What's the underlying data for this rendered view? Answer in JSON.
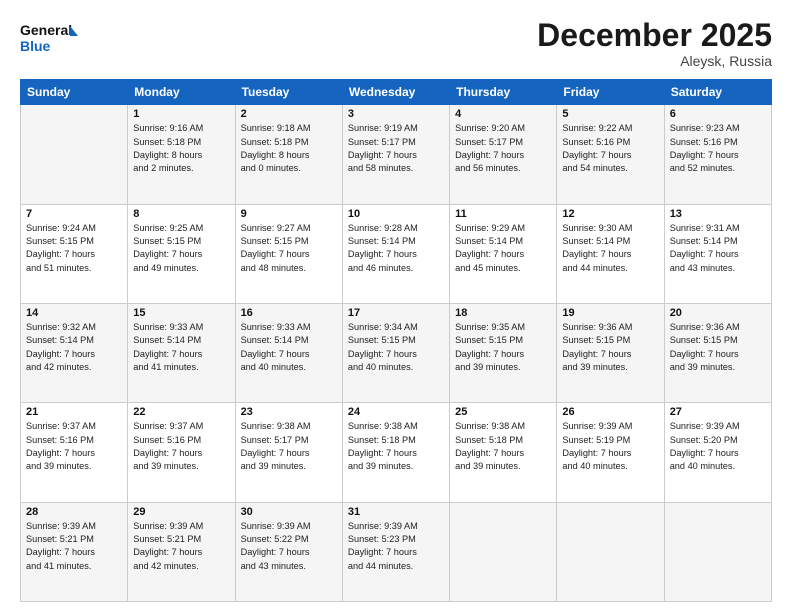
{
  "header": {
    "logo_line1": "General",
    "logo_line2": "Blue",
    "month": "December 2025",
    "location": "Aleysk, Russia"
  },
  "weekdays": [
    "Sunday",
    "Monday",
    "Tuesday",
    "Wednesday",
    "Thursday",
    "Friday",
    "Saturday"
  ],
  "weeks": [
    [
      {
        "day": "",
        "text": ""
      },
      {
        "day": "1",
        "text": "Sunrise: 9:16 AM\nSunset: 5:18 PM\nDaylight: 8 hours\nand 2 minutes."
      },
      {
        "day": "2",
        "text": "Sunrise: 9:18 AM\nSunset: 5:18 PM\nDaylight: 8 hours\nand 0 minutes."
      },
      {
        "day": "3",
        "text": "Sunrise: 9:19 AM\nSunset: 5:17 PM\nDaylight: 7 hours\nand 58 minutes."
      },
      {
        "day": "4",
        "text": "Sunrise: 9:20 AM\nSunset: 5:17 PM\nDaylight: 7 hours\nand 56 minutes."
      },
      {
        "day": "5",
        "text": "Sunrise: 9:22 AM\nSunset: 5:16 PM\nDaylight: 7 hours\nand 54 minutes."
      },
      {
        "day": "6",
        "text": "Sunrise: 9:23 AM\nSunset: 5:16 PM\nDaylight: 7 hours\nand 52 minutes."
      }
    ],
    [
      {
        "day": "7",
        "text": "Sunrise: 9:24 AM\nSunset: 5:15 PM\nDaylight: 7 hours\nand 51 minutes."
      },
      {
        "day": "8",
        "text": "Sunrise: 9:25 AM\nSunset: 5:15 PM\nDaylight: 7 hours\nand 49 minutes."
      },
      {
        "day": "9",
        "text": "Sunrise: 9:27 AM\nSunset: 5:15 PM\nDaylight: 7 hours\nand 48 minutes."
      },
      {
        "day": "10",
        "text": "Sunrise: 9:28 AM\nSunset: 5:14 PM\nDaylight: 7 hours\nand 46 minutes."
      },
      {
        "day": "11",
        "text": "Sunrise: 9:29 AM\nSunset: 5:14 PM\nDaylight: 7 hours\nand 45 minutes."
      },
      {
        "day": "12",
        "text": "Sunrise: 9:30 AM\nSunset: 5:14 PM\nDaylight: 7 hours\nand 44 minutes."
      },
      {
        "day": "13",
        "text": "Sunrise: 9:31 AM\nSunset: 5:14 PM\nDaylight: 7 hours\nand 43 minutes."
      }
    ],
    [
      {
        "day": "14",
        "text": "Sunrise: 9:32 AM\nSunset: 5:14 PM\nDaylight: 7 hours\nand 42 minutes."
      },
      {
        "day": "15",
        "text": "Sunrise: 9:33 AM\nSunset: 5:14 PM\nDaylight: 7 hours\nand 41 minutes."
      },
      {
        "day": "16",
        "text": "Sunrise: 9:33 AM\nSunset: 5:14 PM\nDaylight: 7 hours\nand 40 minutes."
      },
      {
        "day": "17",
        "text": "Sunrise: 9:34 AM\nSunset: 5:15 PM\nDaylight: 7 hours\nand 40 minutes."
      },
      {
        "day": "18",
        "text": "Sunrise: 9:35 AM\nSunset: 5:15 PM\nDaylight: 7 hours\nand 39 minutes."
      },
      {
        "day": "19",
        "text": "Sunrise: 9:36 AM\nSunset: 5:15 PM\nDaylight: 7 hours\nand 39 minutes."
      },
      {
        "day": "20",
        "text": "Sunrise: 9:36 AM\nSunset: 5:15 PM\nDaylight: 7 hours\nand 39 minutes."
      }
    ],
    [
      {
        "day": "21",
        "text": "Sunrise: 9:37 AM\nSunset: 5:16 PM\nDaylight: 7 hours\nand 39 minutes."
      },
      {
        "day": "22",
        "text": "Sunrise: 9:37 AM\nSunset: 5:16 PM\nDaylight: 7 hours\nand 39 minutes."
      },
      {
        "day": "23",
        "text": "Sunrise: 9:38 AM\nSunset: 5:17 PM\nDaylight: 7 hours\nand 39 minutes."
      },
      {
        "day": "24",
        "text": "Sunrise: 9:38 AM\nSunset: 5:18 PM\nDaylight: 7 hours\nand 39 minutes."
      },
      {
        "day": "25",
        "text": "Sunrise: 9:38 AM\nSunset: 5:18 PM\nDaylight: 7 hours\nand 39 minutes."
      },
      {
        "day": "26",
        "text": "Sunrise: 9:39 AM\nSunset: 5:19 PM\nDaylight: 7 hours\nand 40 minutes."
      },
      {
        "day": "27",
        "text": "Sunrise: 9:39 AM\nSunset: 5:20 PM\nDaylight: 7 hours\nand 40 minutes."
      }
    ],
    [
      {
        "day": "28",
        "text": "Sunrise: 9:39 AM\nSunset: 5:21 PM\nDaylight: 7 hours\nand 41 minutes."
      },
      {
        "day": "29",
        "text": "Sunrise: 9:39 AM\nSunset: 5:21 PM\nDaylight: 7 hours\nand 42 minutes."
      },
      {
        "day": "30",
        "text": "Sunrise: 9:39 AM\nSunset: 5:22 PM\nDaylight: 7 hours\nand 43 minutes."
      },
      {
        "day": "31",
        "text": "Sunrise: 9:39 AM\nSunset: 5:23 PM\nDaylight: 7 hours\nand 44 minutes."
      },
      {
        "day": "",
        "text": ""
      },
      {
        "day": "",
        "text": ""
      },
      {
        "day": "",
        "text": ""
      }
    ]
  ]
}
